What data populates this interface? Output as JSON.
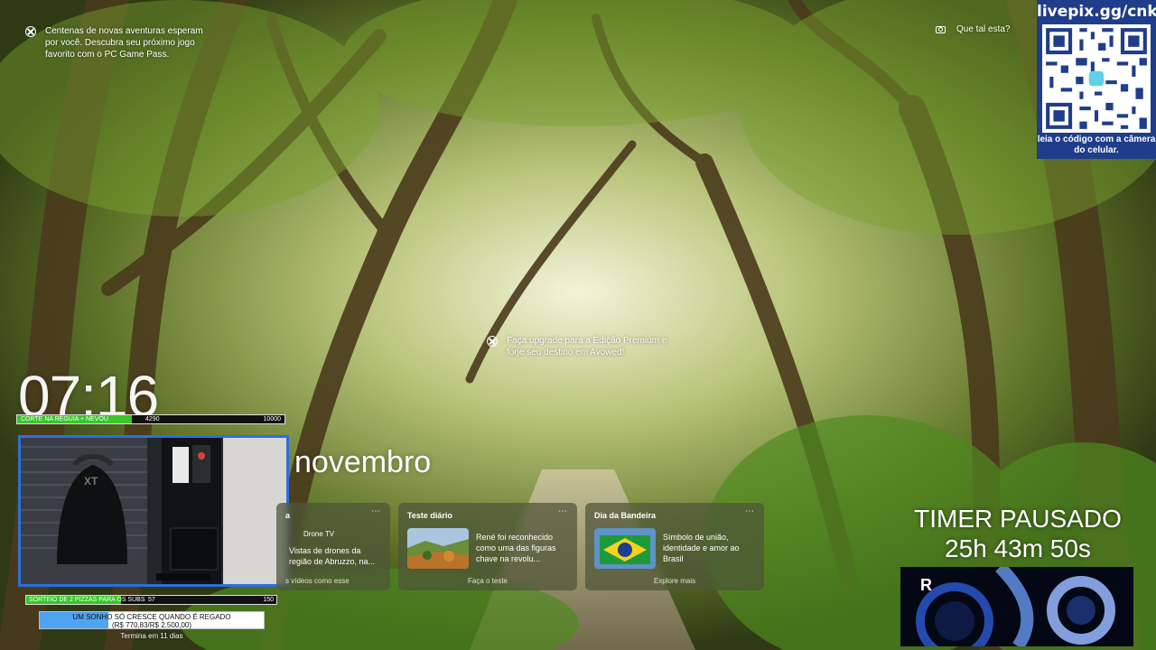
{
  "notifications": {
    "top_left": "Centenas de novas aventuras esperam por você. Descubra seu próximo jogo favorito com o PC Game Pass.",
    "center": "Faça upgrade para a Edição Premium e forje seu destino em Avowed!"
  },
  "spotlight": {
    "label": "Que tal esta?"
  },
  "qr": {
    "url": "livepix.gg/cnk",
    "caption": "leia o código com a câmera do celular."
  },
  "lock": {
    "time": "07:16",
    "date": "novembro"
  },
  "goals": {
    "top": {
      "label": "CORTE NA RÉGUIA + NEVOU",
      "current": "4290",
      "target": "10000",
      "progress": 0.429
    },
    "subs": {
      "label": "SORTEIO DE 2 PIZZAS PARA OS SUBS",
      "current": "57",
      "target": "150",
      "progress": 0.38
    }
  },
  "cards": [
    {
      "title": "a",
      "source": "Drone TV",
      "text": "Vistas de drones da região de Abruzzo, na...",
      "link": "s vídeos como esse"
    },
    {
      "title": "Teste diário",
      "text": "René foi reconhecido como uma das figuras chave na revolu...",
      "link": "Faça o teste"
    },
    {
      "title": "Dia da Bandeira",
      "text": "Símbolo de união, identidade e amor ao Brasil",
      "link": "Explore mais"
    }
  ],
  "timer": {
    "line1": "TIMER PAUSADO",
    "line2": "25h 43m 50s"
  },
  "promo": {
    "letter": "R"
  },
  "donation": {
    "title": "UM SONHO SÓ CRESCE QUANDO É REGADO",
    "amounts": "(R$ 770,83/R$ 2.500,00)",
    "progress": 0.308,
    "footer": "Termina em 11 dias"
  },
  "colors": {
    "goal_fill": "#39c52b",
    "webcam_border": "#2d6fe0",
    "qr_bg": "#1f3d8a",
    "donate_fill": "#4ea3f2"
  }
}
